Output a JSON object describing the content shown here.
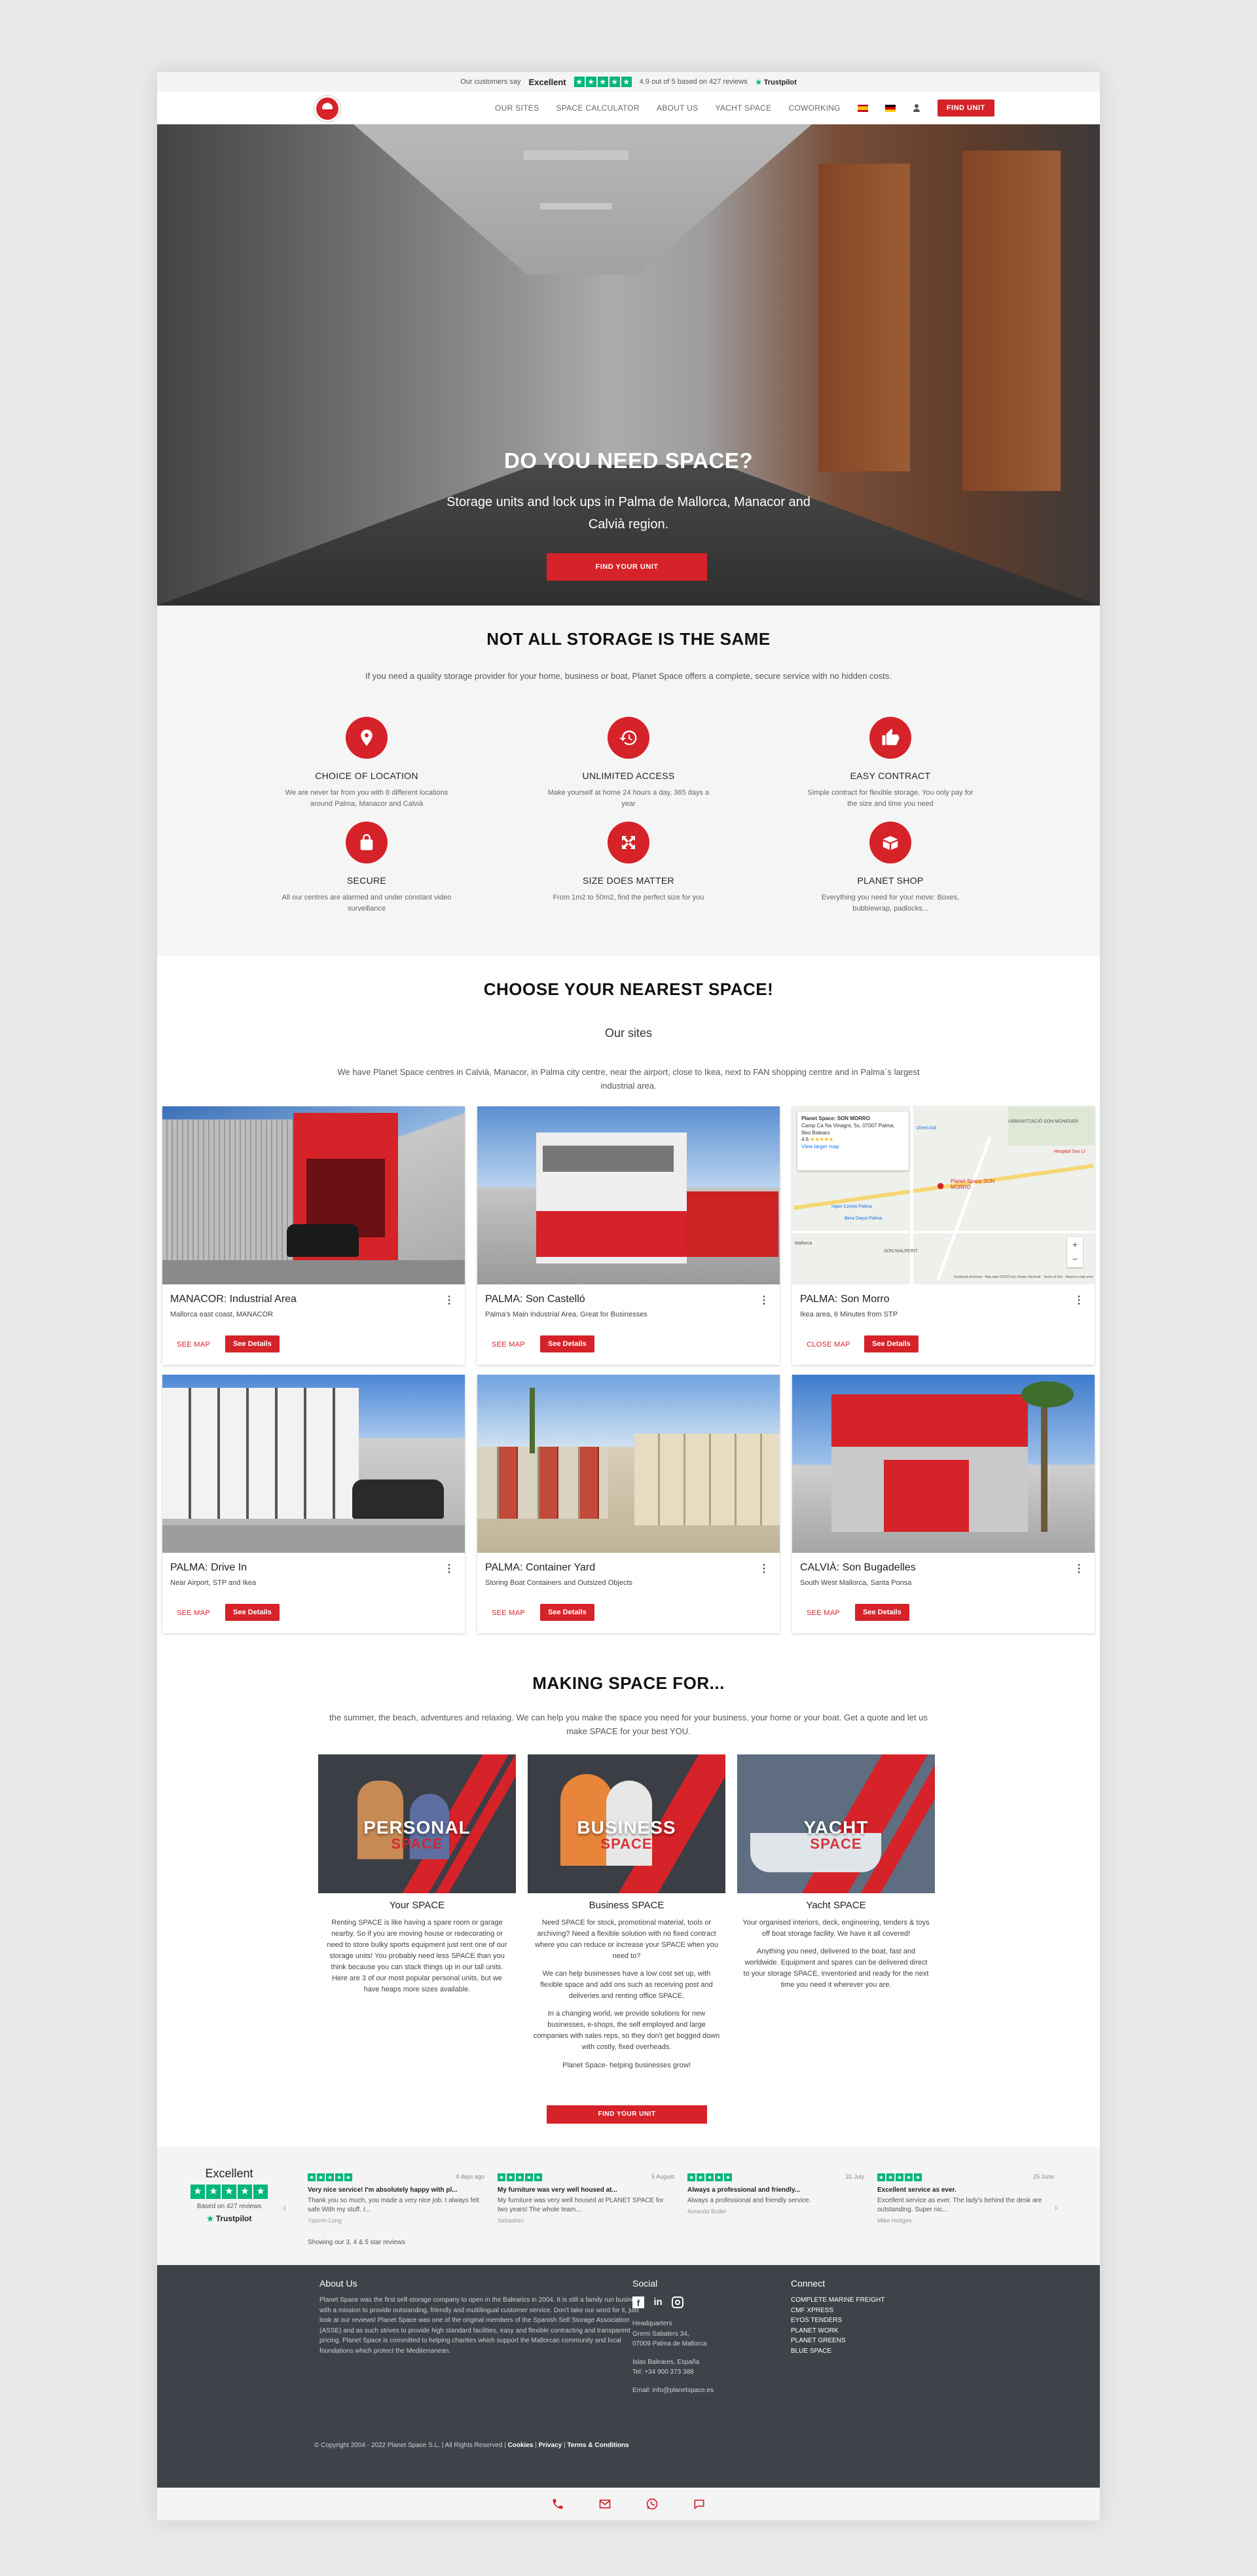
{
  "trustbar": {
    "prefix": "Our customers say",
    "rating_word": "Excellent",
    "score_text": "4.9 out of 5 based on 427 reviews",
    "brand": "Trustpilot"
  },
  "nav": {
    "items": [
      "OUR SITES",
      "SPACE CALCULATOR",
      "ABOUT US",
      "YACHT SPACE",
      "COWORKING"
    ],
    "find_label": "FIND UNIT"
  },
  "hero": {
    "title": "DO YOU NEED SPACE?",
    "subtitle": "Storage units and lock ups in Palma de Mallorca, Manacor and Calvià region.",
    "cta": "FIND YOUR UNIT"
  },
  "features": {
    "title": "NOT ALL STORAGE IS THE SAME",
    "intro": "If you need a quality storage provider for your home, business or boat, Planet Space offers a complete, secure service with no hidden costs.",
    "items": [
      {
        "title": "CHOICE OF LOCATION",
        "text": "We are never far from you with 8 different locations around Palma, Manacor and Calvià",
        "icon": "location-pin-icon"
      },
      {
        "title": "UNLIMITED ACCESS",
        "text": "Make yourself at home 24 hours a day, 365 days a year",
        "icon": "clock-history-icon"
      },
      {
        "title": "EASY CONTRACT",
        "text": "Simple contract for flexible storage. You only pay for the size and time you need",
        "icon": "thumbs-up-icon"
      },
      {
        "title": "SECURE",
        "text": "All our centres are alarmed and under constant video surveillance",
        "icon": "padlock-icon"
      },
      {
        "title": "SIZE DOES MATTER",
        "text": "From 1m2 to 50m2, find the perfect size for you",
        "icon": "expand-arrows-icon"
      },
      {
        "title": "PLANET SHOP",
        "text": "Everything you need for your move: Boxes, bubblewrap, padlocks...",
        "icon": "open-box-icon"
      }
    ]
  },
  "sites": {
    "title": "CHOOSE YOUR NEAREST SPACE!",
    "subtitle": "Our sites",
    "intro": "We have Planet Space centres in Calvià, Manacor, in Palma city centre, near the airport, close to Ikea, next to FAN shopping centre and in Palma´s largest industrial area.",
    "cards": [
      {
        "title": "MANACOR: Industrial Area",
        "sub": "Mallorca east coast, MANACOR",
        "map": "SEE MAP",
        "details": "See Details"
      },
      {
        "title": "PALMA: Son Castelló",
        "sub": "Palma's Main Industrial Area, Great for Businesses",
        "map": "SEE MAP",
        "details": "See Details"
      },
      {
        "title": "PALMA: Son Morro",
        "sub": "Ikea area, 6 Minutes from STP",
        "map": "CLOSE MAP",
        "details": "See Details"
      },
      {
        "title": "PALMA: Drive In",
        "sub": "Near Airport, STP and Ikea",
        "map": "SEE MAP",
        "details": "See Details"
      },
      {
        "title": "PALMA: Container Yard",
        "sub": "Storing Boat Containers and Outsized Objects",
        "map": "SEE MAP",
        "details": "See Details"
      },
      {
        "title": "CALVIÀ: Son Bugadelles",
        "sub": "South West Mallorca, Santa Ponsa",
        "map": "SEE MAP",
        "details": "See Details"
      }
    ],
    "map_popup": {
      "name": "Planet Space: SON MORRO",
      "address": "Camp Ca Na Vinagre, 5s, 07007 Palma, Illes Balears",
      "rating": "4.6",
      "link": "View larger map",
      "labels": [
        "URBANITZACIÓ SON MONEDER",
        "Hospital Son Ll",
        "Planet Space SON MORRO",
        "Hiper Centro Palma",
        "Birra Depot Palma",
        "SON MALFERIT",
        "Mallorca",
        "Direct Aid"
      ],
      "footer": "Keyboard shortcuts · Map data ©2022 Inst. Geogr. Nacional · Terms of Use · Report a map error"
    }
  },
  "making": {
    "title": "MAKING SPACE FOR...",
    "intro": "the summer, the beach, adventures and relaxing. We can help you make the space you need for your business, your home or your boat. Get a quote and let us make SPACE for your best YOU.",
    "promos": [
      {
        "word": "PERSONAL",
        "word2": "SPACE",
        "title": "Your SPACE",
        "paras": [
          "Renting SPACE is like having a spare room or garage nearby. So if you are moving house or redecorating or need to store bulky sports equipment just rent one of our storage units! You probably need less SPACE than you think because you can stack things up in our tall units. Here are 3 of our most popular personal units, but we have heaps more sizes available."
        ]
      },
      {
        "word": "BUSINESS",
        "word2": "SPACE",
        "title": "Business SPACE",
        "paras": [
          "Need SPACE for stock, promotional material, tools or archiving? Need a flexible solution with no fixed contract where you can reduce or increase your SPACE when you need to?",
          "We can help businesses have a low cost set up, with flexible space and add ons such as receiving post and deliveries and renting office SPACE.",
          "In a changing world, we provide solutions for new businesses, e-shops, the self employed and large companies with sales reps, so they don't get bogged down with costly, fixed overheads.",
          "Planet Space- helping businesses grow!"
        ]
      },
      {
        "word": "YACHT",
        "word2": "SPACE",
        "title": "Yacht SPACE",
        "paras": [
          "Your organised interiors, deck, engineering, tenders & toys off boat storage facility. We have it all covered!",
          "Anything you need, delivered to the boat, fast and worldwide. Equipment and spares can be delivered direct to your storage SPACE, inventoried and ready for the next time you need it wherever you are."
        ]
      }
    ],
    "cta": "FIND YOUR UNIT"
  },
  "reviews": {
    "summary_word": "Excellent",
    "based_on": "Based on 427 reviews",
    "brand": "Trustpilot",
    "showing": "Showing our 3, 4 & 5 star reviews",
    "items": [
      {
        "when": "4 days ago",
        "title": "Very nice service! I'm absolutely happy with pl...",
        "text": "Thank you so much, you made a very nice job. I always felt safe With my stuff. I...",
        "who": "Yasmin Long"
      },
      {
        "when": "5 August",
        "title": "My furniture was very well housed at...",
        "text": "My furniture was very well housed at PLANET SPACE for two years! The whole team...",
        "who": "Sebastian"
      },
      {
        "when": "31 July",
        "title": "Always a professional and friendly...",
        "text": "Always a professional and friendly service.",
        "who": "Amanda Butler"
      },
      {
        "when": "25 June",
        "title": "Excellent service as ever.",
        "text": "Excellent service as ever. The lady's behind the desk are outstanding. Super nic...",
        "who": "Mike Hodges"
      }
    ]
  },
  "footer": {
    "about_title": "About Us",
    "about_text": "Planet Space was the first self-storage company to open in the Balearics in 2004. It is still a family run business with a mission to provide outstanding, friendly and multilingual customer service. Don't take our word for it, just look at our reviews! Planet Space was one of the original members of the Spanish Self Storage Association (ASSE) and as such strives to provide high standard facilities, easy and flexible contracting and transparent pricing. Planet Space is committed to helping charities which support the Mallorcan community and local foundations which protect the Mediterranean.",
    "social_title": "Social",
    "hq_lines": [
      "Headquarters",
      "Gremi Sabaters 34,",
      "07009 Palma de Mallorca",
      "",
      "Islas Baleares, España",
      "Tel: +34 900 373 388",
      "",
      "Email: info@planetspace.es"
    ],
    "connect_title": "Connect",
    "connect_items": [
      "COMPLETE MARINE FREIGHT",
      "CMF XPRESS",
      "EYOS TENDERS",
      "PLANET WORK",
      "PLANET GREENS",
      "BLUE SPACE"
    ],
    "copyright": "© Copyright 2004 - 2022 Planet Space S.L. | All Rights Reserved |",
    "links": [
      "Cookies",
      "Privacy",
      "Terms & Conditions"
    ]
  },
  "colors": {
    "accent": "#d62229",
    "footer": "#3e4249",
    "trustpilot": "#00b67a"
  }
}
